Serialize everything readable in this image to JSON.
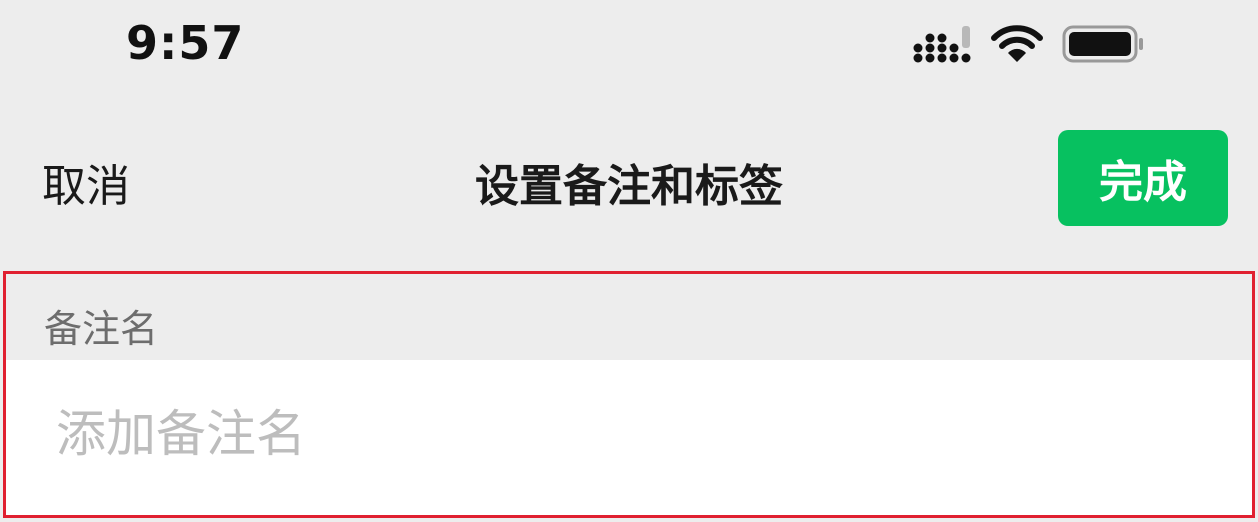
{
  "status_bar": {
    "time": "9:57",
    "icons": [
      "signal-icon",
      "wifi-icon",
      "battery-icon"
    ]
  },
  "nav": {
    "cancel_label": "取消",
    "title": "设置备注和标签",
    "done_label": "完成"
  },
  "remark": {
    "section_label": "备注名",
    "placeholder": "添加备注名",
    "value": ""
  },
  "colors": {
    "accent": "#07c160",
    "background": "#ededed",
    "highlight_border": "#e02030",
    "placeholder": "#bdbdbd"
  }
}
